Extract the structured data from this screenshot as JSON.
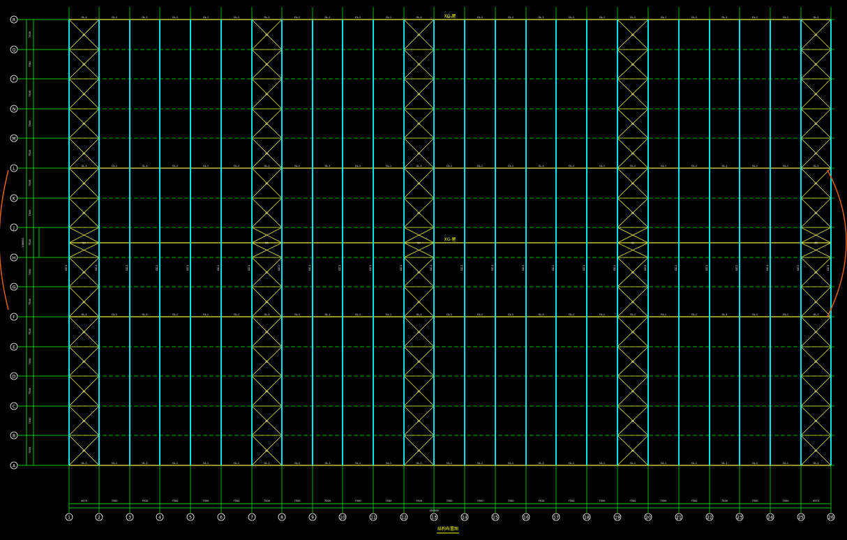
{
  "drawing": {
    "colors": {
      "background": "#000000",
      "column_line": "#00e5e5",
      "beam_line": "#e8e840",
      "grid_line": "#00b400",
      "bracing": "#e8e840",
      "dimension": "#00c800",
      "label": "#ffffff",
      "title": "#ffff00",
      "annotation": "#e06010"
    },
    "col_axes": [
      "1",
      "2",
      "3",
      "4",
      "5",
      "6",
      "7",
      "8",
      "9",
      "10",
      "11",
      "12",
      "13",
      "14",
      "15",
      "16",
      "17",
      "18",
      "19",
      "20",
      "21",
      "22",
      "23",
      "24",
      "25",
      "26"
    ],
    "row_axes": [
      "R",
      "Q",
      "P",
      "N",
      "M",
      "L",
      "K",
      "J",
      "H",
      "G",
      "F",
      "E",
      "D",
      "C",
      "B",
      "A"
    ],
    "braced_bays": [
      1,
      7,
      12,
      19,
      25
    ],
    "bay_dims": [
      "4575",
      "7500",
      "7500",
      "7500",
      "7500",
      "7500",
      "7500",
      "7500",
      "7500",
      "7500",
      "7500",
      "7500",
      "7500",
      "7500",
      "7500",
      "7500",
      "7500",
      "7500",
      "7500",
      "7500",
      "7500",
      "7500",
      "7500",
      "7500",
      "4575"
    ],
    "overall_dim": "181500",
    "row_dims": [
      "7500",
      "7500",
      "7500",
      "7500",
      "7500",
      "7500",
      "7500",
      "7500",
      "7500",
      "7500",
      "7500",
      "7500",
      "7500",
      "7500",
      "7500"
    ],
    "overall_row_dim": "108000",
    "column_mark": "GZ-1",
    "beam_mark": "GL-1",
    "brace_mark": "SC",
    "center_label": "XG-屋",
    "top_label": "XG-屋",
    "title": "结构布置图"
  }
}
